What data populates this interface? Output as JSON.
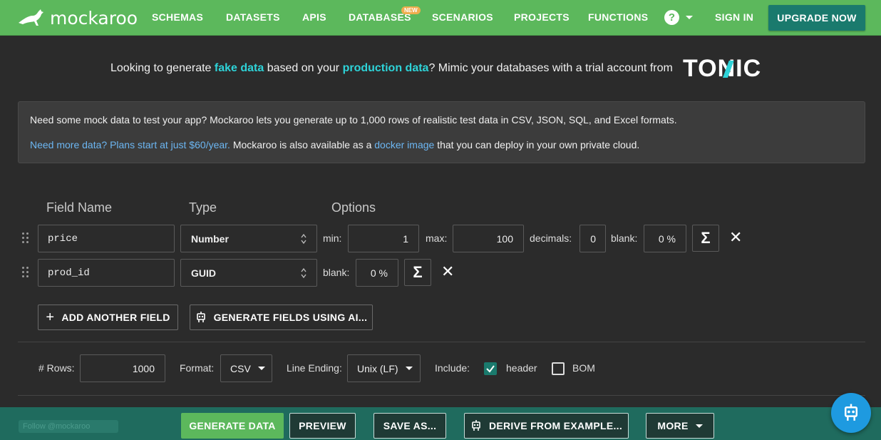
{
  "nav": {
    "brand": "mockaroo",
    "items": [
      "SCHEMAS",
      "DATASETS",
      "APIS",
      "DATABASES",
      "SCENARIOS",
      "PROJECTS",
      "FUNCTIONS"
    ],
    "new_badge": "NEW",
    "help": "?",
    "sign_in": "SIGN IN",
    "upgrade": "UPGRADE NOW"
  },
  "promo": {
    "text1": "Looking to generate ",
    "hl1": "fake data",
    "text2": " based on your ",
    "hl2": "production data",
    "text3": "? Mimic your databases with a trial account from",
    "brand": "TONIC"
  },
  "info": {
    "line1": "Need some mock data to test your app? Mockaroo lets you generate up to 1,000 rows of realistic test data in CSV, JSON, SQL, and Excel formats.",
    "plans_link": "Need more data? Plans start at just $60/year.",
    "mid": " Mockaroo is also available as a ",
    "docker_link": "docker image",
    "end": " that you can deploy in your own private cloud."
  },
  "columns": {
    "name": "Field Name",
    "type": "Type",
    "options": "Options"
  },
  "fields": [
    {
      "name": "price",
      "type": "Number",
      "min_label": "min:",
      "min": "1",
      "max_label": "max:",
      "max": "100",
      "decimals_label": "decimals:",
      "decimals": "0",
      "blank_label": "blank:",
      "blank": "0 %"
    },
    {
      "name": "prod_id",
      "type": "GUID",
      "blank_label": "blank:",
      "blank": "0 %"
    }
  ],
  "sigma": "Σ",
  "remove": "✕",
  "add_field": "ADD ANOTHER FIELD",
  "add_plus": "+",
  "gen_ai": "GENERATE FIELDS USING AI...",
  "options": {
    "rows_label": "# Rows:",
    "rows": "1000",
    "format_label": "Format:",
    "format": "CSV",
    "line_ending_label": "Line Ending:",
    "line_ending": "Unix (LF)",
    "include_label": "Include:",
    "header_label": "header",
    "header_checked": true,
    "bom_label": "BOM",
    "bom_checked": false
  },
  "footer": {
    "follow": "Follow @mockaroo",
    "generate": "GENERATE DATA",
    "preview": "PREVIEW",
    "save_as": "SAVE AS...",
    "derive": "DERIVE FROM EXAMPLE...",
    "more": "MORE"
  },
  "colors": {
    "nav": "#5cb85c",
    "accent": "#1a7a6d",
    "highlight": "#2ed3d8",
    "link": "#6cb6f2",
    "footer": "#1f6b5e"
  }
}
